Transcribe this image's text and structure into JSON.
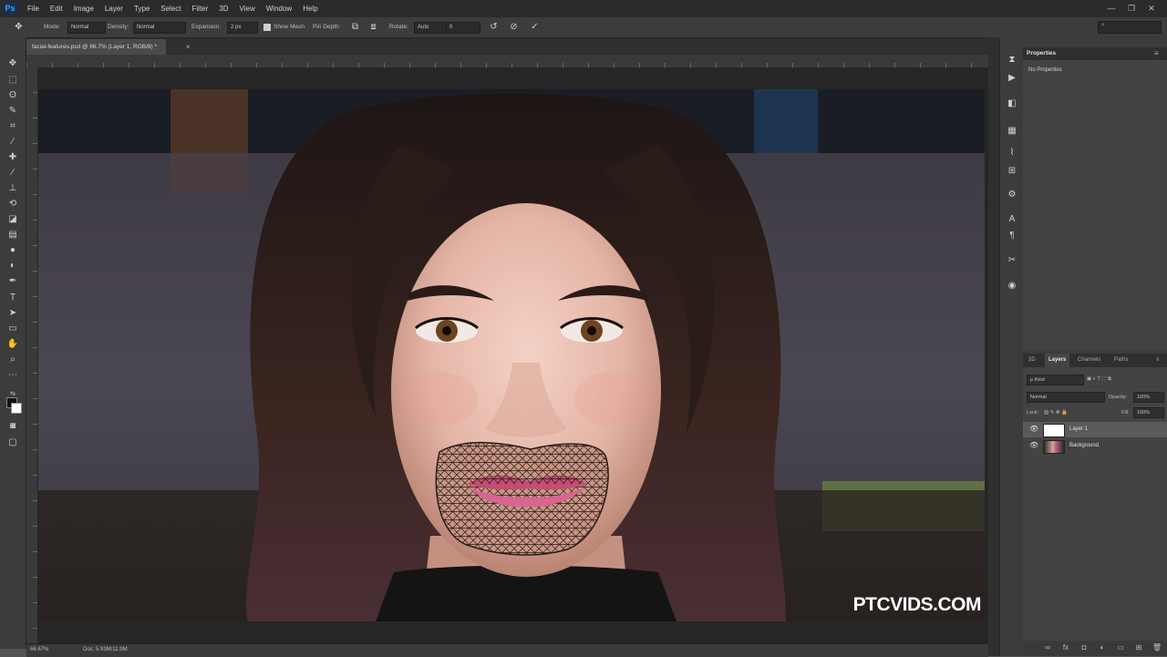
{
  "app": {
    "logo": "Ps"
  },
  "menu": [
    "File",
    "Edit",
    "Image",
    "Layer",
    "Type",
    "Select",
    "Filter",
    "3D",
    "View",
    "Window",
    "Help"
  ],
  "window_controls": [
    "—",
    "❐",
    "✕"
  ],
  "options_bar": {
    "mode_label": "Mode:",
    "mode_value": "Normal",
    "density_label": "Density:",
    "density_value": "Normal",
    "expansion_label": "Expansion:",
    "expansion_value": "2 px",
    "show_mesh": "Show Mesh",
    "pin_depth_label": "Pin Depth:",
    "rotate_label": "Rotate:",
    "rotate_value": "Auto",
    "rotate_degrees": "0"
  },
  "document": {
    "tab_title": "facial-features.psd @ 66.7% (Layer 1, RGB/8) *",
    "close": "×"
  },
  "status": {
    "zoom": "66.67%",
    "doc_info": "Doc: 5.93M/11.9M"
  },
  "watermark": "PTCVIDS.COM",
  "properties": {
    "tab": "Properties",
    "empty_text": "No Properties",
    "menu_icon": "≡"
  },
  "layers_panel": {
    "tabs": [
      "3D",
      "Layers",
      "Channels",
      "Paths"
    ],
    "active_tab": "Layers",
    "filter_kind": "ρ Kind",
    "blend_mode": "Normal",
    "opacity_label": "Opacity:",
    "opacity_value": "100%",
    "lock_label": "Lock:",
    "fill_label": "Fill:",
    "fill_value": "100%",
    "layers": [
      {
        "name": "Layer 1",
        "selected": true,
        "thumb": "white"
      },
      {
        "name": "Background",
        "selected": false,
        "thumb": "photo"
      }
    ]
  },
  "colors": {
    "menubar_bg": "#2b2b2b",
    "panel_bg": "#3c3c3c",
    "workspace_bg": "#535353",
    "accent": "#31a8ff"
  },
  "icons": {
    "tools": [
      "move-icon",
      "marquee-icon",
      "lasso-icon",
      "quick-select-icon",
      "crop-icon",
      "eyedropper-icon",
      "healing-brush-icon",
      "brush-icon",
      "clone-stamp-icon",
      "history-brush-icon",
      "eraser-icon",
      "gradient-icon",
      "blur-icon",
      "dodge-icon",
      "pen-icon",
      "type-icon",
      "path-select-icon",
      "shape-icon",
      "hand-icon",
      "zoom-icon",
      "more-tools-icon"
    ],
    "strip": [
      "history-icon",
      "actions-icon",
      "adjustments-icon",
      "swatches-icon",
      "brushes-icon",
      "clone-source-icon",
      "character-icon",
      "paragraph-icon",
      "tools-preset-icon",
      "3d-icon"
    ]
  }
}
